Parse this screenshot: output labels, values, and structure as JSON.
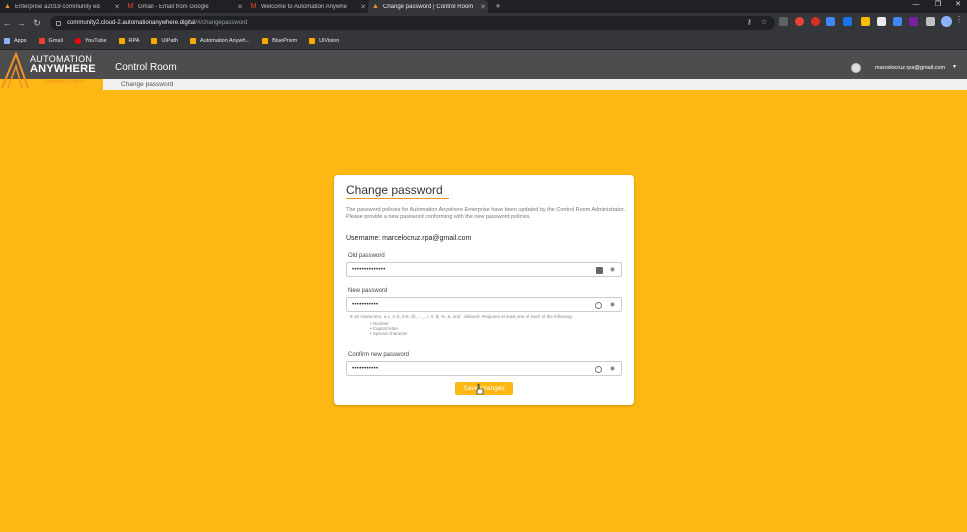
{
  "browser": {
    "tabs": [
      {
        "title": "Enterprise a2019 community ed",
        "favicon": "aa-icon",
        "color": "#f29223"
      },
      {
        "title": "Gmail - Email from Google",
        "favicon": "gmail-icon",
        "color": "#ea4335"
      },
      {
        "title": "Welcome to Automation Anywhe",
        "favicon": "gmail-icon",
        "color": "#ea4335"
      },
      {
        "title": "Change password | Control Room",
        "favicon": "aa-icon",
        "color": "#f29223",
        "active": true
      }
    ],
    "url_host": "community2.cloud-2.automationanywhere.digital",
    "url_path": "/#/changepassword",
    "bookmarks": [
      {
        "label": "Apps",
        "icon": "apps-grid-icon",
        "color": "#8ab4f8"
      },
      {
        "label": "Gmail",
        "icon": "gmail-icon",
        "color": "#ea4335"
      },
      {
        "label": "YouTube",
        "icon": "youtube-icon",
        "color": "#ff0000"
      },
      {
        "label": "RPA",
        "icon": "folder-icon",
        "color": "#f9ab00"
      },
      {
        "label": "UiPath",
        "icon": "folder-icon",
        "color": "#f9ab00"
      },
      {
        "label": "Automation Anywh...",
        "icon": "folder-icon",
        "color": "#f9ab00"
      },
      {
        "label": "BluePrism",
        "icon": "folder-icon",
        "color": "#f9ab00"
      },
      {
        "label": "UiVision",
        "icon": "folder-icon",
        "color": "#f9ab00"
      }
    ]
  },
  "app": {
    "logo_line1": "AUTOMATION",
    "logo_line2": "ANYWHERE",
    "logo_line3": "Community Edition",
    "title": "Control Room",
    "user_email": "marcelocruz.rpa@gmail.com",
    "breadcrumb": "Change password",
    "colors": {
      "accent": "#f29223",
      "background": "#fdb813",
      "header": "#4d4d4f"
    }
  },
  "form": {
    "title": "Change password",
    "description": "The password policies for Automation Anywhere Enterprise have been updated by the Control Room Administrator. Please provide a new password conforming with the new password policies.",
    "username_label": "Username: marcelocruz.rpa@gmail.com",
    "old_password": {
      "label": "Old password",
      "value": "••••••••••••••"
    },
    "new_password": {
      "label": "New password",
      "value": "•••••••••••"
    },
    "hint": "8-15 characters, a-z, A-Z, 0-9, @, -, _, !, #, $, %, &, and . allowed. Requires at least one of each of the following:",
    "rules": [
      "Number",
      "Capital letter",
      "Special character"
    ],
    "confirm_password": {
      "label": "Confirm new password",
      "value": "•••••••••••"
    },
    "save_label": "Save changes"
  }
}
